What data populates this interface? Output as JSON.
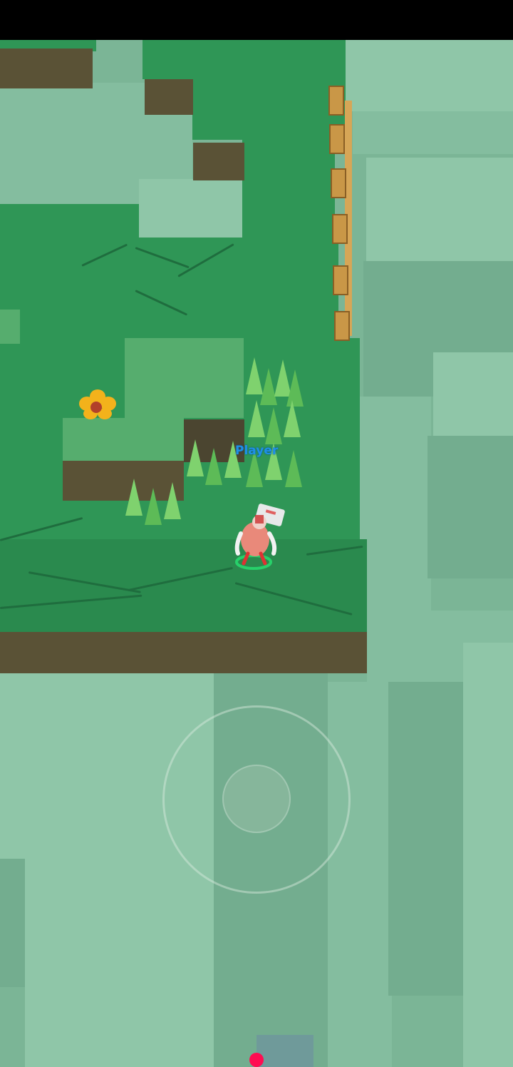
{
  "player": {
    "name": "Player"
  },
  "colors": {
    "grass": "#2f9656",
    "fog": "#84bd9f",
    "label": "#1e90e8",
    "marker": "#ff0c52"
  },
  "icons": {
    "flower": "flower-icon",
    "joystick": "virtual-joystick"
  }
}
